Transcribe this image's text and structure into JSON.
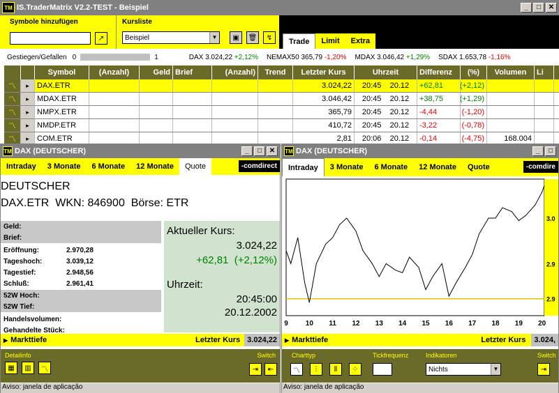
{
  "main_window": {
    "title": "IS.TraderMatrix V2.2-TEST  -  Beispiel",
    "symbole_label": "Symbole hinzufügen",
    "kursliste_label": "Kursliste",
    "kursliste_value": "Beispiel",
    "tabs": [
      "Trade",
      "Limit",
      "Extra"
    ],
    "gestiegen_label": "Gestiegen/Gefallen",
    "gestiegen_left": "0",
    "gestiegen_right": "1",
    "ticker": [
      {
        "name": "DAX",
        "value": "3.024,22",
        "change": "+2,12%",
        "dir": "pos"
      },
      {
        "name": "NEMAX50",
        "value": "365,79",
        "change": "-1,20%",
        "dir": "neg"
      },
      {
        "name": "MDAX",
        "value": "3.046,42",
        "change": "+1,29%",
        "dir": "pos"
      },
      {
        "name": "SDAX",
        "value": "1.653,78",
        "change": "-1,16%",
        "dir": "neg"
      }
    ],
    "columns": [
      "Symbol",
      "(Anzahl)",
      "Geld",
      "Brief",
      "(Anzahl)",
      "Trend",
      "Letzter Kurs",
      "Uhrzeit",
      "Differenz",
      "(%)",
      "Volumen",
      "Li"
    ],
    "rows": [
      {
        "symbol": "DAX.ETR",
        "kurs": "3.024,22",
        "zeit": "20:45",
        "datum": "20.12",
        "diff": "+62,81",
        "pct": "(+2,12)",
        "vol": "",
        "dir": "pos",
        "selected": true
      },
      {
        "symbol": "MDAX.ETR",
        "kurs": "3.046,42",
        "zeit": "20:45",
        "datum": "20.12",
        "diff": "+38,75",
        "pct": "(+1,29)",
        "vol": "",
        "dir": "pos",
        "selected": false
      },
      {
        "symbol": "NMPX.ETR",
        "kurs": "365,79",
        "zeit": "20:45",
        "datum": "20.12",
        "diff": "-4,44",
        "pct": "(-1,20)",
        "vol": "",
        "dir": "neg",
        "selected": false
      },
      {
        "symbol": "NMDP.ETR",
        "kurs": "410,72",
        "zeit": "20:45",
        "datum": "20.12",
        "diff": "-3,22",
        "pct": "(-0,78)",
        "vol": "",
        "dir": "neg",
        "selected": false
      },
      {
        "symbol": "COM.ETR",
        "kurs": "2,81",
        "zeit": "20:06",
        "datum": "20.12",
        "diff": "-0,14",
        "pct": "(-4,75)",
        "vol": "168.004",
        "dir": "neg",
        "selected": false
      }
    ]
  },
  "quote_window": {
    "title": "DAX (DEUTSCHER)",
    "tabs": [
      "Intraday",
      "3 Monate",
      "6 Monate",
      "12 Monate",
      "Quote"
    ],
    "brand": "-comdirect",
    "name": "DEUTSCHER",
    "symbol_line": "DAX.ETR  WKN: 846900  Börse: ETR",
    "fields": [
      {
        "label": "Geld:",
        "value": ""
      },
      {
        "label": "Brief:",
        "value": ""
      },
      {
        "label": "Eröffnung:",
        "value": "2.970,28"
      },
      {
        "label": "Tageshoch:",
        "value": "3.039,12"
      },
      {
        "label": "Tagestief:",
        "value": "2.948,56"
      },
      {
        "label": "Schluß:",
        "value": "2.961,41"
      },
      {
        "label": "52W Hoch:",
        "value": ""
      },
      {
        "label": "52W Tief:",
        "value": ""
      },
      {
        "label": "Handelsvolumen:",
        "value": ""
      },
      {
        "label": "Gehandelte Stück:",
        "value": ""
      }
    ],
    "aktueller_label": "Aktueller Kurs:",
    "aktueller_value": "3.024,22",
    "aktueller_change": "+62,81  (+2,12%)",
    "uhrzeit_label": "Uhrzeit:",
    "uhrzeit_time": "20:45:00",
    "uhrzeit_date": "20.12.2002",
    "markttiefe": "Markttiefe",
    "letzter_label": "Letzter Kurs",
    "letzter_value": "3.024,22",
    "detailinfo": "Detailinfo",
    "switch": "Switch",
    "status": "Aviso: janela de aplicação"
  },
  "chart_window": {
    "title": "DAX (DEUTSCHER)",
    "tabs": [
      "Intraday",
      "3 Monate",
      "6 Monate",
      "12 Monate",
      "Quote"
    ],
    "brand": "-comdire",
    "markttiefe": "Markttiefe",
    "letzter_label": "Letzter Kurs",
    "letzter_value": "3.024,",
    "charttyp": "Charttyp",
    "tickfrequenz": "Tickfrequenz",
    "indikatoren": "Indikatoren",
    "indikatoren_value": "Nichts",
    "switch": "Switch",
    "status": "Aviso: janela de aplicação"
  },
  "chart_data": {
    "type": "line",
    "x_ticks": [
      "9",
      "10",
      "11",
      "12",
      "13",
      "14",
      "15",
      "16",
      "17",
      "18",
      "19",
      "20"
    ],
    "y_ticks": [
      "3.0",
      "2.9",
      "2.9"
    ],
    "reference_line": 2948,
    "x": [
      9,
      9.2,
      9.5,
      9.8,
      10,
      10.3,
      10.7,
      11,
      11.3,
      11.6,
      12,
      12.3,
      12.7,
      13,
      13.3,
      13.7,
      14,
      14.3,
      14.7,
      15,
      15.3,
      15.7,
      16,
      16.3,
      16.7,
      17,
      17.3,
      17.7,
      18,
      18.3,
      18.7,
      19,
      19.3,
      19.7,
      20,
      20.1
    ],
    "values": [
      2985,
      2975,
      2995,
      2960,
      2945,
      2975,
      2990,
      2995,
      3005,
      3010,
      3000,
      2985,
      2975,
      2965,
      2975,
      2970,
      2968,
      2980,
      2972,
      2955,
      2965,
      2975,
      2950,
      2960,
      2972,
      2982,
      2998,
      3010,
      3010,
      3018,
      3015,
      3008,
      3012,
      3020,
      3030,
      3035
    ]
  }
}
